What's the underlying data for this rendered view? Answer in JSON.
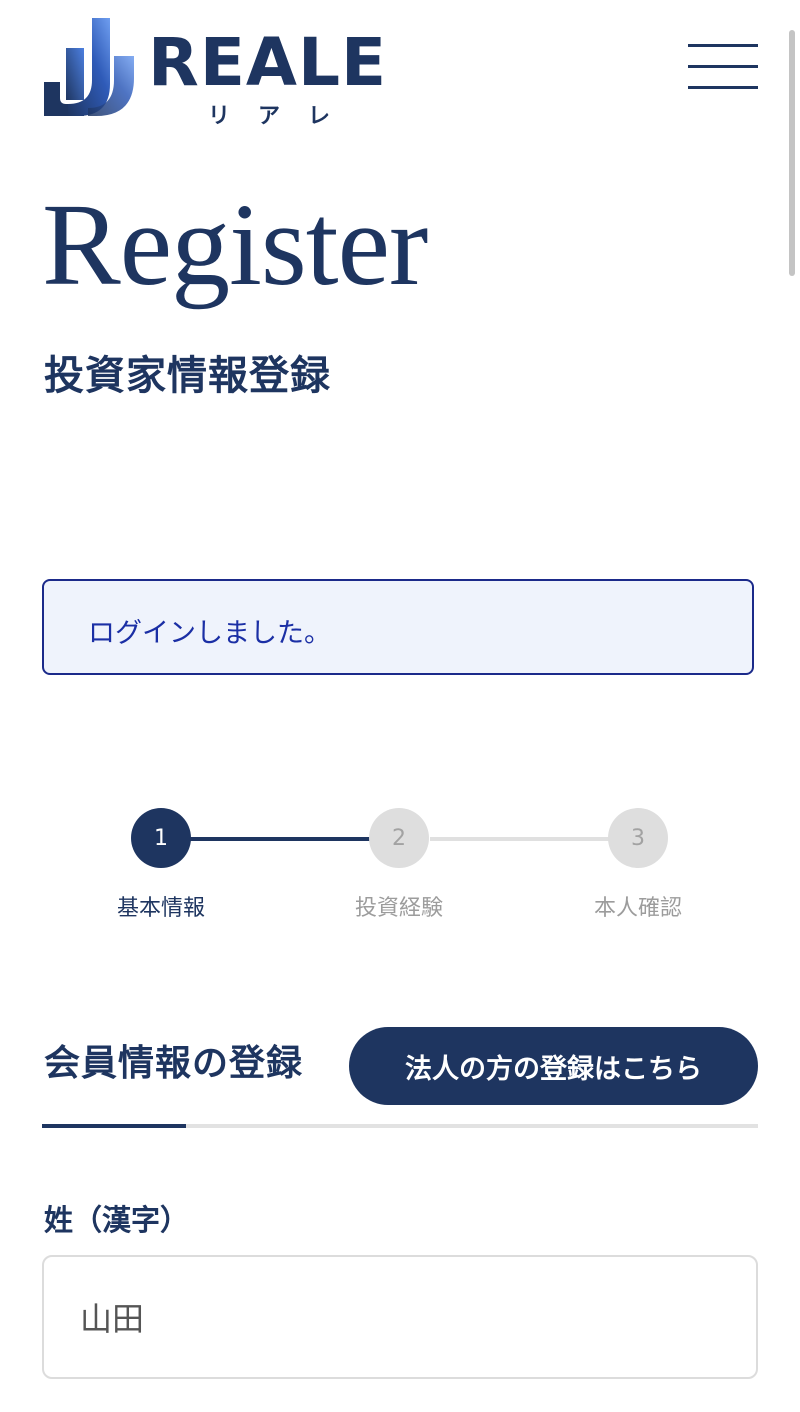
{
  "brand": {
    "name": "REALE",
    "kana": "リアレ",
    "colors": {
      "navy": "#1e3560",
      "alert_border": "#1b2a8a",
      "alert_bg": "#eff3fc",
      "alert_text": "#1b2fa5"
    }
  },
  "header": {
    "menu_icon": "hamburger-menu-icon"
  },
  "hero": {
    "title": "Register",
    "subtitle": "投資家情報登録"
  },
  "alert": {
    "message": "ログインしました。"
  },
  "stepper": {
    "current": 1,
    "steps": [
      {
        "number": "1",
        "label": "基本情報",
        "state": "active"
      },
      {
        "number": "2",
        "label": "投資経験",
        "state": "idle"
      },
      {
        "number": "3",
        "label": "本人確認",
        "state": "idle"
      }
    ]
  },
  "section": {
    "title": "会員情報の登録",
    "corporate_button": "法人の方の登録はこちら"
  },
  "form": {
    "last_name_kanji": {
      "label": "姓（漢字）",
      "value": "山田"
    }
  }
}
